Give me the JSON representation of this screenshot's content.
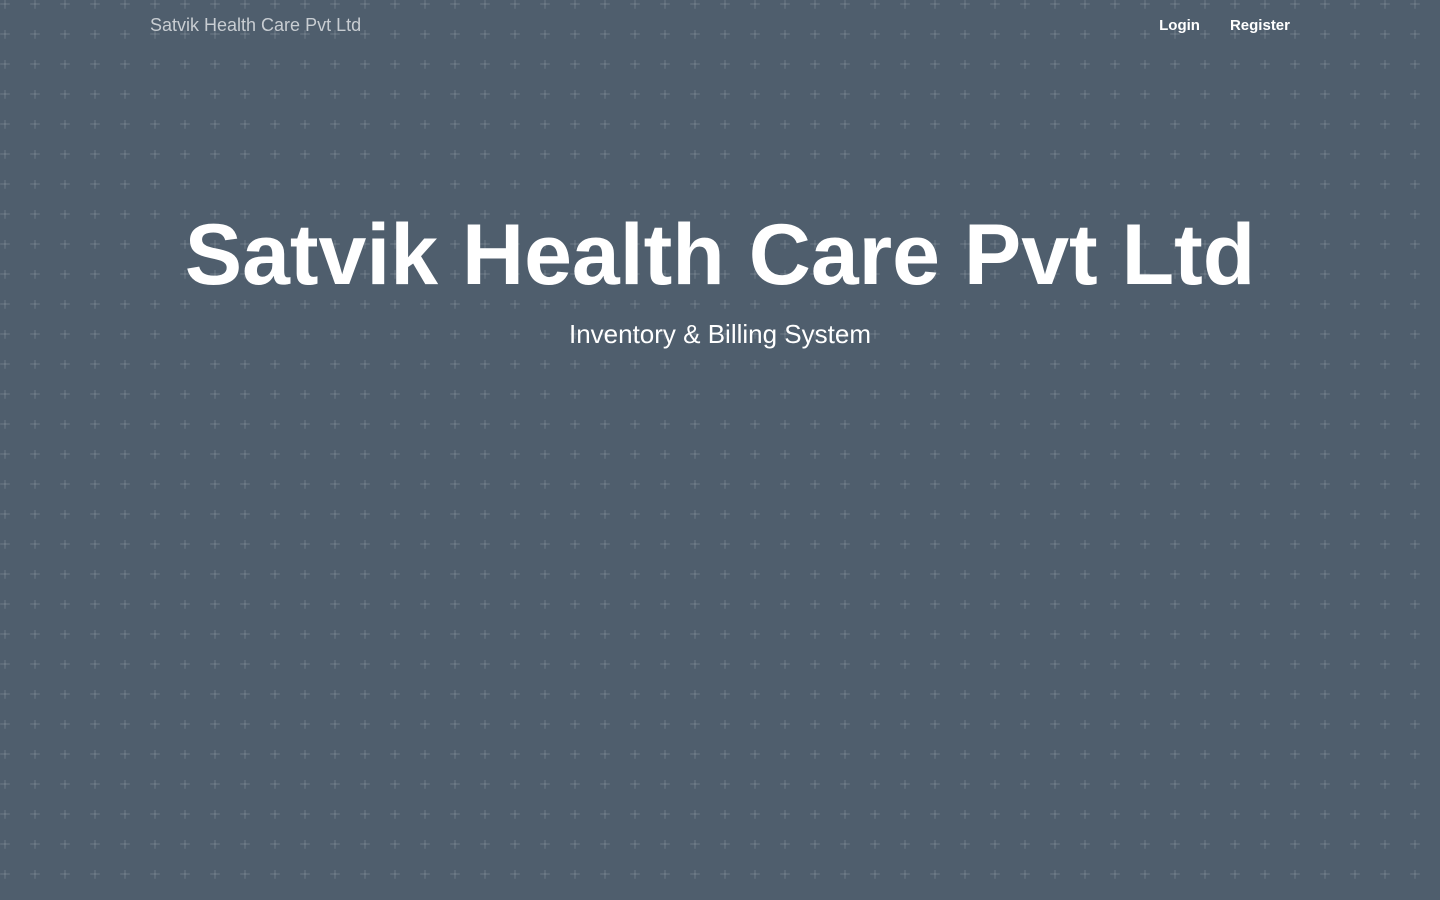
{
  "navbar": {
    "brand": "Satvik Health Care Pvt Ltd",
    "links": [
      {
        "label": "Login"
      },
      {
        "label": "Register"
      }
    ]
  },
  "hero": {
    "title": "Satvik Health Care Pvt Ltd",
    "subtitle": "Inventory & Billing System"
  },
  "colors": {
    "background": "#253849",
    "text": "#ffffff",
    "brand_text": "#c8cdd2"
  }
}
